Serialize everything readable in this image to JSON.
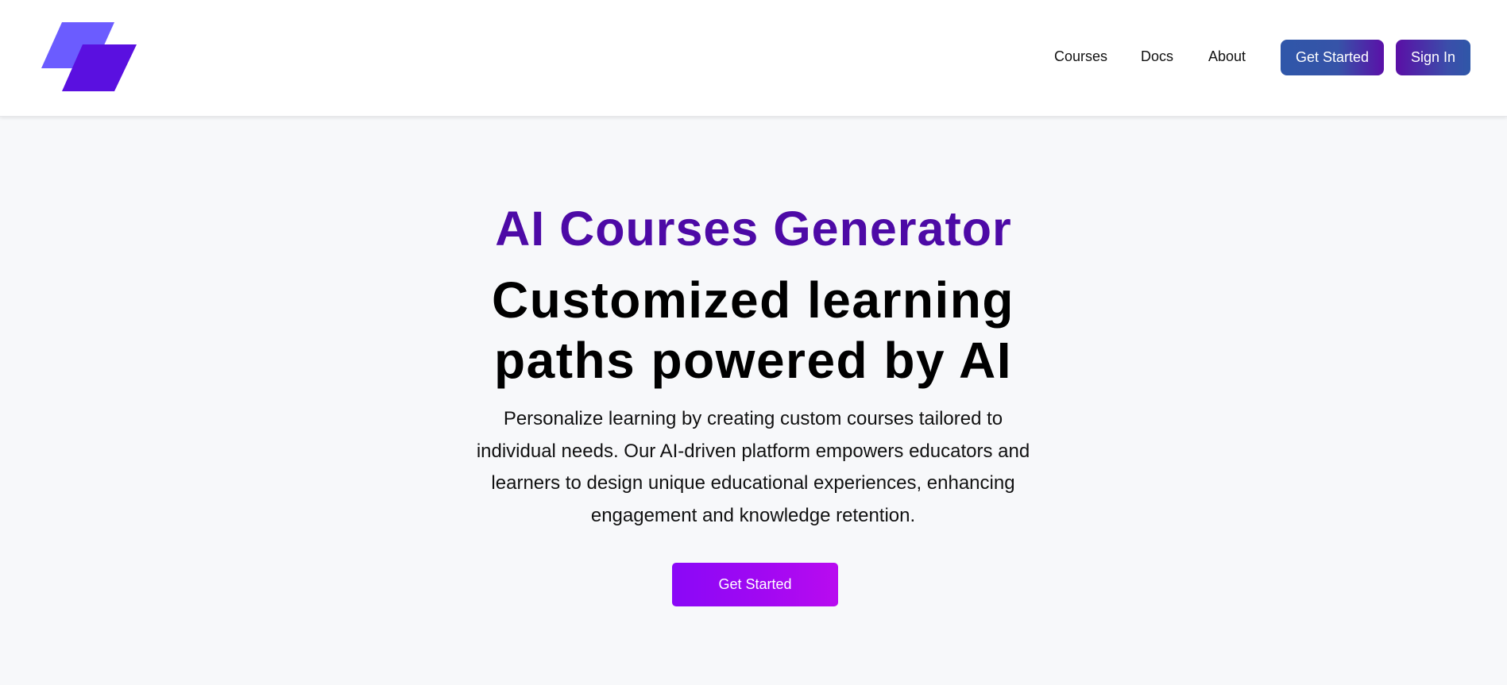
{
  "header": {
    "nav": {
      "courses": "Courses",
      "docs": "Docs",
      "about": "About"
    },
    "get_started_label": "Get Started",
    "sign_in_label": "Sign In",
    "logo_icon": "stacked-parallelograms-logo-icon"
  },
  "hero": {
    "eyebrow": "AI Courses Generator",
    "title": "Customized learning paths powered by AI",
    "description": "Personalize learning by creating custom courses tailored to individual needs. Our AI-driven platform empowers educators and learners to design unique educational experiences, enhancing engagement and knowledge retention.",
    "cta_label": "Get Started"
  },
  "colors": {
    "accent_purple": "#4d0aa6",
    "cta_gradient_start": "#8a08f7",
    "cta_gradient_end": "#b90bf0",
    "header_button_blue": "#2f56a9",
    "logo_light": "#6b5cff",
    "logo_dark": "#5a10e0",
    "page_background": "#f7f8fa"
  }
}
